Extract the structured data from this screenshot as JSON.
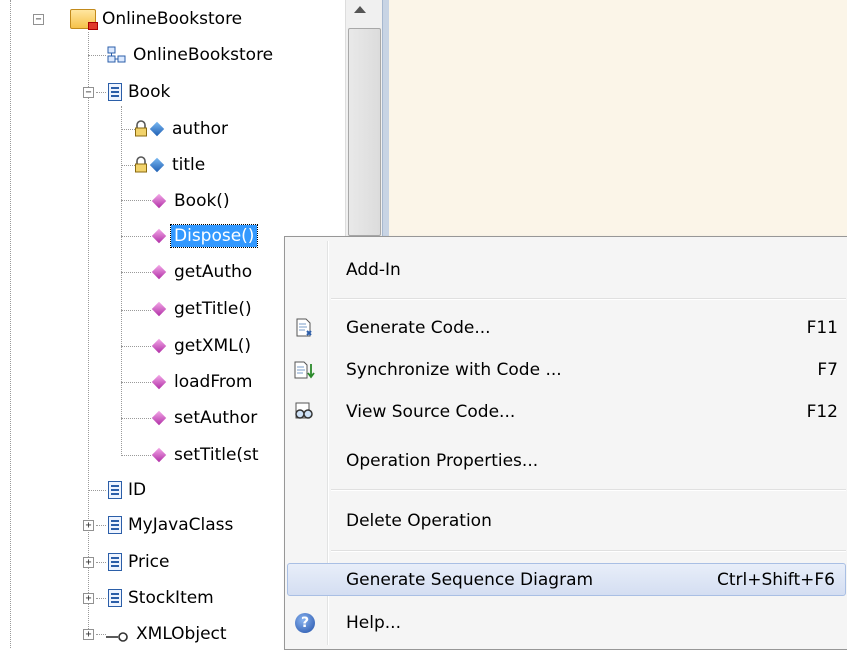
{
  "tree": {
    "nodes": [
      {
        "label": "OnlineBookstore",
        "icon": "package-folder-icon",
        "expander": "minus"
      },
      {
        "label": "OnlineBookstore",
        "icon": "diagram-icon"
      },
      {
        "label": "Book",
        "icon": "class-icon",
        "expander": "minus"
      },
      {
        "label": "author",
        "icon": "private-attribute-icon"
      },
      {
        "label": "title",
        "icon": "private-attribute-icon"
      },
      {
        "label": "Book()",
        "icon": "operation-icon"
      },
      {
        "label": "Dispose()",
        "icon": "operation-icon",
        "selected": true
      },
      {
        "label": "getAutho",
        "icon": "operation-icon"
      },
      {
        "label": "getTitle()",
        "icon": "operation-icon"
      },
      {
        "label": "getXML()",
        "icon": "operation-icon"
      },
      {
        "label": "loadFrom",
        "icon": "operation-icon"
      },
      {
        "label": "setAuthor",
        "icon": "operation-icon"
      },
      {
        "label": "setTitle(st",
        "icon": "operation-icon"
      },
      {
        "label": "ID",
        "icon": "class-icon"
      },
      {
        "label": "MyJavaClass",
        "icon": "class-icon",
        "expander": "plus"
      },
      {
        "label": "Price",
        "icon": "class-icon",
        "expander": "plus"
      },
      {
        "label": "StockItem",
        "icon": "class-icon",
        "expander": "plus"
      },
      {
        "label": "XMLObject",
        "icon": "interface-icon",
        "expander": "plus"
      }
    ]
  },
  "context_menu": {
    "add_in": "Add-In",
    "generate_code": "Generate Code...",
    "generate_code_key": "F11",
    "synchronize": "Synchronize with Code ...",
    "synchronize_key": "F7",
    "view_source": "View Source Code...",
    "view_source_key": "F12",
    "operation_properties": "Operation Properties...",
    "delete_operation": "Delete Operation",
    "generate_sequence": "Generate Sequence Diagram",
    "generate_sequence_key": "Ctrl+Shift+F6",
    "help": "Help...",
    "help_glyph": "?",
    "highlighted_item": "Generate Sequence Diagram"
  },
  "colors": {
    "selection": "#3399ff",
    "menu_highlight": "#d4def2",
    "canvas": "#fbf5e8"
  }
}
